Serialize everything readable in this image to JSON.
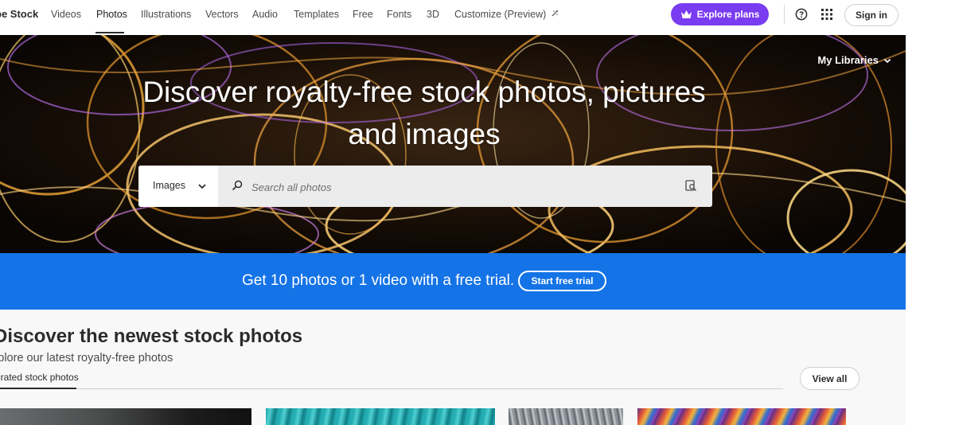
{
  "nav": {
    "brand": "be Stock",
    "items": [
      {
        "label": "Videos"
      },
      {
        "label": "Photos"
      },
      {
        "label": "Illustrations"
      },
      {
        "label": "Vectors"
      },
      {
        "label": "Audio"
      },
      {
        "label": "Templates"
      },
      {
        "label": "Free"
      },
      {
        "label": "Fonts"
      },
      {
        "label": "3D"
      },
      {
        "label": "Customize (Preview)"
      }
    ],
    "explore_label": "Explore plans",
    "signin_label": "Sign in"
  },
  "hero": {
    "my_libraries": "My Libraries",
    "title_line1": "Discover royalty-free stock photos, pictures",
    "title_line2": "and images",
    "search": {
      "type_label": "Images",
      "placeholder": "Search all photos",
      "value": ""
    }
  },
  "promo": {
    "text": "Get 10 photos or 1 video with a free trial.",
    "button": "Start free trial"
  },
  "section": {
    "title": "Discover the newest stock photos",
    "subtitle": "xplore our latest royalty-free photos",
    "tab": "urated stock photos",
    "view_all": "View all"
  },
  "colors": {
    "accent_purple": "#7a3cf0",
    "promo_blue": "#1473e6"
  }
}
